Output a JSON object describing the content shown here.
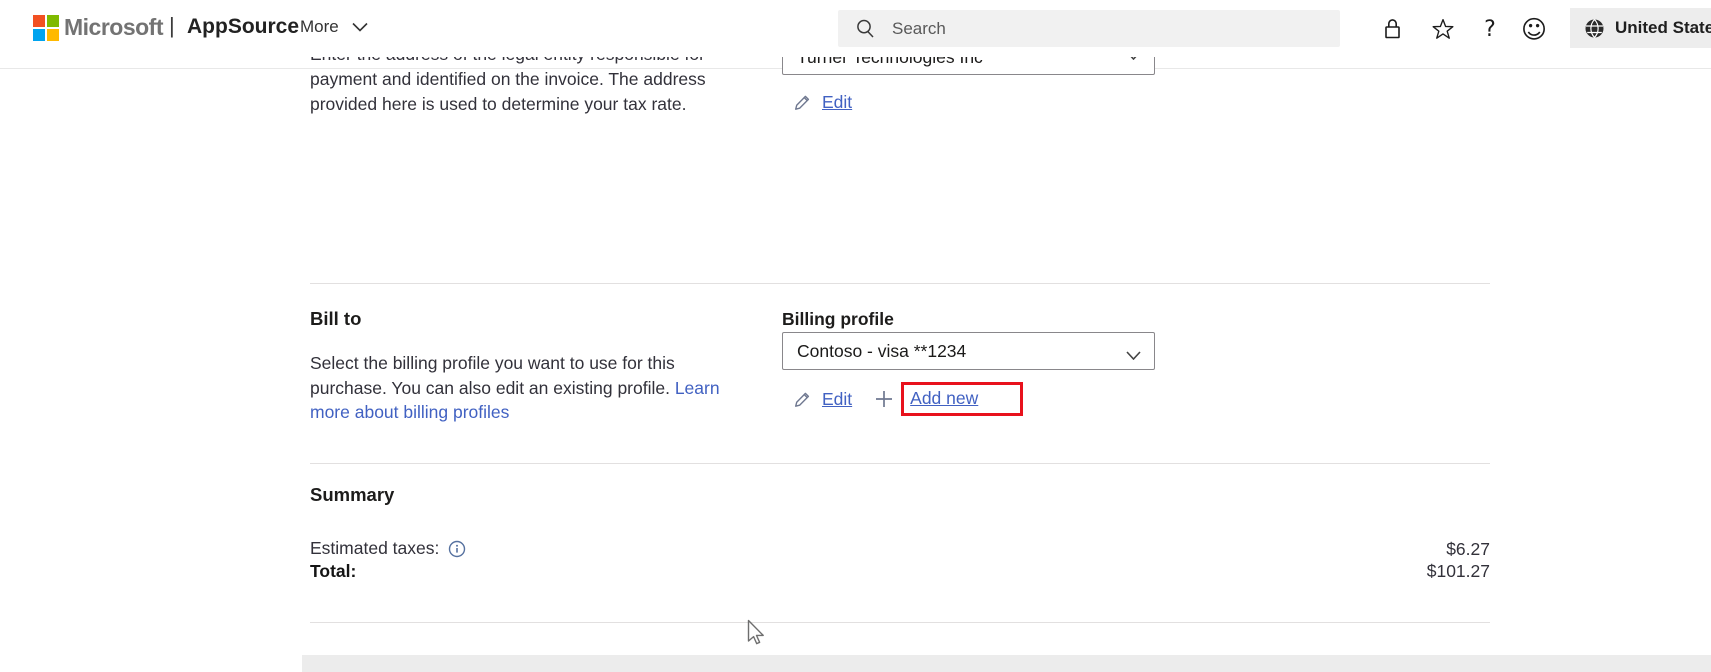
{
  "header": {
    "microsoft_label": "Microsoft",
    "separator": "|",
    "appsource_label": "AppSource",
    "more_label": "More",
    "search_placeholder": "Search",
    "region_label": "United States",
    "icon_names": [
      "search-icon",
      "lock-icon",
      "favorites-star-icon",
      "help-icon",
      "feedback-smiley-icon",
      "globe-icon",
      "chevron-down-icon"
    ],
    "help_glyph": "?",
    "star_glyph": "☆",
    "smiley_glyph": "☺"
  },
  "sold_to": {
    "description_lines": [
      "Enter the address of the legal entity responsible for",
      "payment and identified on the invoice. The address",
      "provided here is used to determine your tax rate."
    ],
    "legal_entity_value": "Turner Technologies Inc",
    "edit_label": "Edit"
  },
  "bill_to": {
    "heading": "Bill to",
    "description_line1": "Select the billing profile you want to use for this",
    "description_line2_text": "purchase. You can also edit an existing profile. ",
    "description_line2_link": "Learn",
    "description_line3_link": "more about billing profiles",
    "billing_profile_label": "Billing profile",
    "billing_profile_value": "Contoso - visa **1234",
    "edit_label": "Edit",
    "add_new_label": "Add new"
  },
  "summary": {
    "heading": "Summary",
    "estimated_taxes_label": "Estimated taxes:",
    "estimated_taxes_value": "$6.27",
    "total_label": "Total:",
    "total_value": "$101.27"
  },
  "colors": {
    "link_blue": "#4161c2",
    "highlight_red": "#e8111c",
    "search_bg": "#f1f1f1",
    "region_bg": "#ededed",
    "bottom_bar_bg": "#ececec",
    "divider": "#e2e0e0",
    "microsoft_gray": "#737373",
    "logo_red": "#f25022",
    "logo_green": "#7fba00",
    "logo_blue": "#00a4ef",
    "logo_yellow": "#ffb900"
  }
}
